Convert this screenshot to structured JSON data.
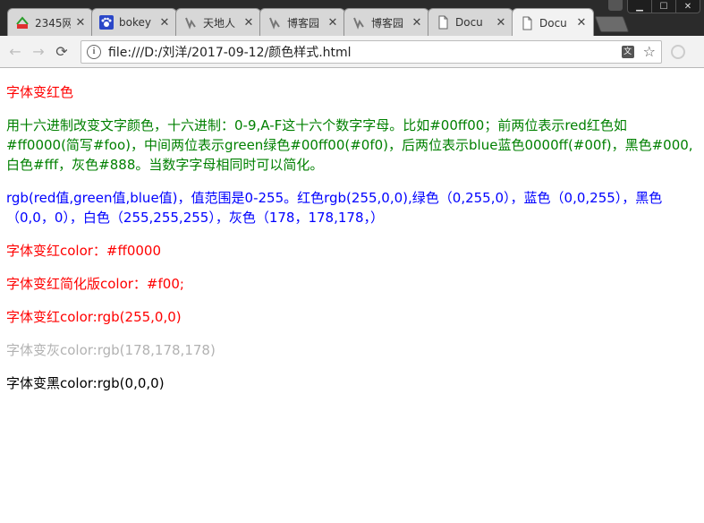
{
  "tabs": [
    {
      "title": "2345网",
      "icon": "2345-logo-icon",
      "active": false
    },
    {
      "title": "bokey",
      "icon": "paw-icon",
      "active": false
    },
    {
      "title": "天地人",
      "icon": "site-logo-icon",
      "active": false
    },
    {
      "title": "博客园",
      "icon": "site-logo-icon",
      "active": false
    },
    {
      "title": "博客园",
      "icon": "site-logo-icon",
      "active": false
    },
    {
      "title": "Docu",
      "icon": "document-icon",
      "active": false
    },
    {
      "title": "Docu",
      "icon": "document-icon",
      "active": true
    }
  ],
  "toolbar": {
    "url": "file:///D:/刘洋/2017-09-12/颜色样式.html"
  },
  "content": {
    "lines": [
      {
        "text": "字体变红色",
        "color": "#ff0000"
      },
      {
        "text": "用十六进制改变文字颜色，十六进制：0-9,A-F这十六个数字字母。比如#00ff00；前两位表示red红色如#ff0000(简写#foo)，中间两位表示green绿色#00ff00(#0f0)，后两位表示blue蓝色0000ff(#00f)，黑色#000,白色#fff，灰色#888。当数字字母相同时可以简化。",
        "color": "#008000"
      },
      {
        "text": "rgb(red值,green值,blue值)，值范围是0-255。红色rgb(255,0,0),绿色（0,255,0），蓝色（0,0,255），黑色（0,0，0），白色（255,255,255），灰色（178，178,178，）",
        "color": "#0000ff"
      },
      {
        "text": "字体变红color：#ff0000",
        "color": "#ff0000"
      },
      {
        "text": "字体变红简化版color：#f00;",
        "color": "#ff0000"
      },
      {
        "text": "字体变红color:rgb(255,0,0)",
        "color": "#ff0000"
      },
      {
        "text": "字体变灰color:rgb(178,178,178)",
        "color": "#b2b2b2"
      },
      {
        "text": "字体变黑color:rgb(0,0,0)",
        "color": "#000000"
      }
    ]
  }
}
